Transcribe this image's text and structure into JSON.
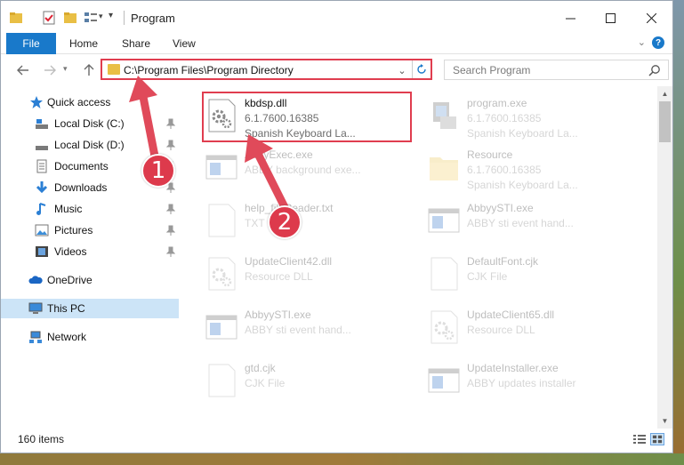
{
  "window": {
    "title": "Program"
  },
  "ribbon": {
    "tabs": [
      "File",
      "Home",
      "Share",
      "View"
    ]
  },
  "address": {
    "path": "C:\\Program Files\\Program Directory"
  },
  "search": {
    "placeholder": "Search Program"
  },
  "sidebar": {
    "items": [
      {
        "label": "Quick access",
        "icon": "star-icon"
      },
      {
        "label": "Local Disk (C:)",
        "icon": "drive-icon"
      },
      {
        "label": "Local Disk (D:)",
        "icon": "drive-icon"
      },
      {
        "label": "Documents",
        "icon": "documents-icon"
      },
      {
        "label": "Downloads",
        "icon": "download-icon"
      },
      {
        "label": "Music",
        "icon": "music-icon"
      },
      {
        "label": "Pictures",
        "icon": "pictures-icon"
      },
      {
        "label": "Videos",
        "icon": "videos-icon"
      },
      {
        "label": "OneDrive",
        "icon": "cloud-icon"
      },
      {
        "label": "This PC",
        "icon": "computer-icon"
      },
      {
        "label": "Network",
        "icon": "network-icon"
      }
    ]
  },
  "files": [
    {
      "name": "kbdsp.dll",
      "line1": "6.1.7600.16385",
      "line2": "Spanish Keyboard La...",
      "icon": "dll-gear-icon",
      "highlighted": true
    },
    {
      "name": "program.exe",
      "line1": "6.1.7600.16385",
      "line2": "Spanish Keyboard La...",
      "icon": "exe-icon"
    },
    {
      "name": "AbbyExec.exe",
      "line1": "ABBY background exe...",
      "line2": "",
      "icon": "window-app-icon"
    },
    {
      "name": "Resource",
      "line1": "6.1.7600.16385",
      "line2": "Spanish Keyboard La...",
      "icon": "folder-icon"
    },
    {
      "name": "help_fileReader.txt",
      "line1": "TXT File",
      "line2": "",
      "icon": "text-file-icon"
    },
    {
      "name": "AbbyySTI.exe",
      "line1": "ABBY sti event hand...",
      "line2": "",
      "icon": "window-app-icon"
    },
    {
      "name": "UpdateClient42.dll",
      "line1": "Resource DLL",
      "line2": "",
      "icon": "dll-gear-icon"
    },
    {
      "name": "DefaultFont.cjk",
      "line1": "CJK File",
      "line2": "",
      "icon": "blank-file-icon"
    },
    {
      "name": "AbbyySTI.exe",
      "line1": "ABBY sti event hand...",
      "line2": "",
      "icon": "window-app-icon"
    },
    {
      "name": "UpdateClient65.dll",
      "line1": "Resource DLL",
      "line2": "",
      "icon": "dll-gear-icon"
    },
    {
      "name": "gtd.cjk",
      "line1": "CJK File",
      "line2": "",
      "icon": "blank-file-icon"
    },
    {
      "name": "UpdateInstaller.exe",
      "line1": "ABBY updates installer",
      "line2": "",
      "icon": "window-app-icon"
    }
  ],
  "status": {
    "item_count": "160 items"
  },
  "annotations": {
    "step1": "1",
    "step2": "2"
  },
  "colors": {
    "accent": "#1979ca",
    "highlight": "#e03d4f",
    "selected": "#cce4f7"
  }
}
